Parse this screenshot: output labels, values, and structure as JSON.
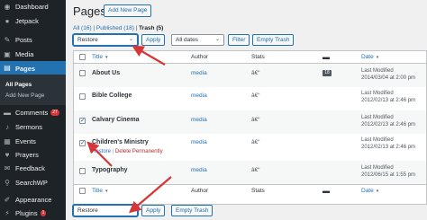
{
  "sidebar": {
    "items": [
      {
        "label": "Dashboard",
        "icon": "dashboard-icon",
        "glyph": "◉"
      },
      {
        "label": "Jetpack",
        "icon": "jetpack-icon",
        "glyph": "●"
      },
      {
        "label": "Posts",
        "icon": "pin-icon",
        "glyph": "✎"
      },
      {
        "label": "Media",
        "icon": "media-icon",
        "glyph": "▣"
      },
      {
        "label": "Pages",
        "icon": "pages-icon",
        "glyph": "▤"
      },
      {
        "label": "Comments",
        "icon": "comment-icon",
        "glyph": "▬",
        "badge": "27"
      },
      {
        "label": "Sermons",
        "icon": "sermons-icon",
        "glyph": "♪"
      },
      {
        "label": "Events",
        "icon": "events-icon",
        "glyph": "▦"
      },
      {
        "label": "Prayers",
        "icon": "prayers-icon",
        "glyph": "♥"
      },
      {
        "label": "Feedback",
        "icon": "feedback-icon",
        "glyph": "✉"
      },
      {
        "label": "SearchWP",
        "icon": "searchwp-icon",
        "glyph": "⚲"
      },
      {
        "label": "Appearance",
        "icon": "appearance-icon",
        "glyph": "✐"
      },
      {
        "label": "Plugins",
        "icon": "plugins-icon",
        "glyph": "⚡",
        "badge": "1"
      }
    ],
    "submenu": [
      {
        "label": "All Pages"
      },
      {
        "label": "Add New Page"
      }
    ]
  },
  "header": {
    "title": "Pages",
    "add_new_label": "Add New Page"
  },
  "filters": {
    "all": "All",
    "all_count": "(16)",
    "published": "Published",
    "published_count": "(18)",
    "trash": "Trash",
    "trash_count": "(5)",
    "sep": " | "
  },
  "top_actions": {
    "bulk_value": "Restore",
    "apply_label": "Apply",
    "dates_value": "All dates",
    "filter_label": "Filter",
    "empty_trash_label": "Empty Trash"
  },
  "bottom_actions": {
    "bulk_value": "Restore",
    "apply_label": "Apply",
    "empty_trash_label": "Empty Trash"
  },
  "table": {
    "columns": {
      "title": "Title",
      "author": "Author",
      "stats": "Stats",
      "date": "Date"
    },
    "rows": [
      {
        "title": "About Us",
        "author": "media",
        "stats": "â€“",
        "comments": "18",
        "date_status": "Last Modified",
        "date": "2014/03/04 at 2:00 pm",
        "checked": false
      },
      {
        "title": "Bible College",
        "author": "media",
        "stats": "â€“",
        "comments": "",
        "date_status": "Last Modified",
        "date": "2012/02/13 at 2:46 pm",
        "checked": false
      },
      {
        "title": "Calvary Cinema",
        "author": "media",
        "stats": "â€“",
        "comments": "",
        "date_status": "Last Modified",
        "date": "2012/02/13 at 2:46 pm",
        "checked": true
      },
      {
        "title": "Children's Ministry",
        "author": "media",
        "stats": "â€“",
        "comments": "",
        "date_status": "Last Modified",
        "date": "2012/02/13 at 2:46 pm",
        "checked": true,
        "actions": {
          "restore": "Restore",
          "sep": " | ",
          "delete": "Delete Permanently"
        }
      },
      {
        "title": "Typography",
        "author": "media",
        "stats": "â€“",
        "comments": "",
        "date_status": "Last Modified",
        "date": "2012/06/15 at 1:55 pm",
        "checked": false
      }
    ]
  },
  "colors": {
    "accent": "#2271b1",
    "sidebar_bg": "#1d2327",
    "annotation_arrow": "#d63638",
    "delete": "#b32d2e"
  }
}
